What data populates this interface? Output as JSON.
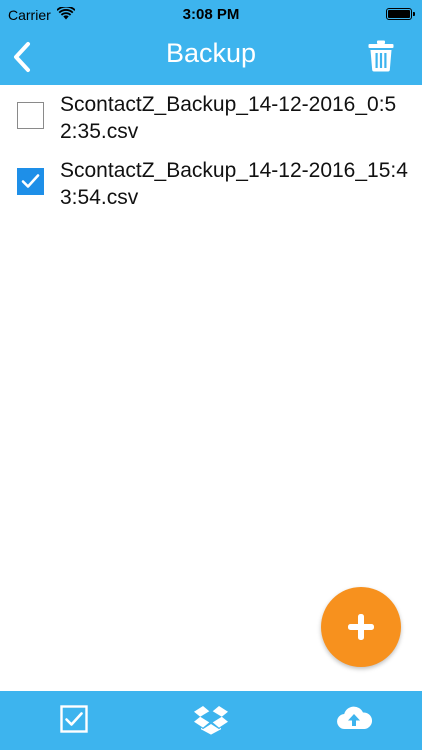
{
  "status": {
    "carrier": "Carrier",
    "time": "3:08 PM"
  },
  "nav": {
    "title": "Backup"
  },
  "files": [
    {
      "name": "ScontactZ_Backup_14-12-2016_0:52:35.csv",
      "checked": false
    },
    {
      "name": "ScontactZ_Backup_14-12-2016_15:43:54.csv",
      "checked": true
    }
  ],
  "icons": {
    "back": "chevron-left-icon",
    "trash": "trash-icon",
    "add": "plus-icon",
    "select_all": "checkbox-icon",
    "dropbox": "dropbox-icon",
    "upload": "cloud-upload-icon"
  },
  "colors": {
    "primary": "#3DB4EE",
    "accent": "#F7911E",
    "checkbox": "#1E8FE8"
  }
}
